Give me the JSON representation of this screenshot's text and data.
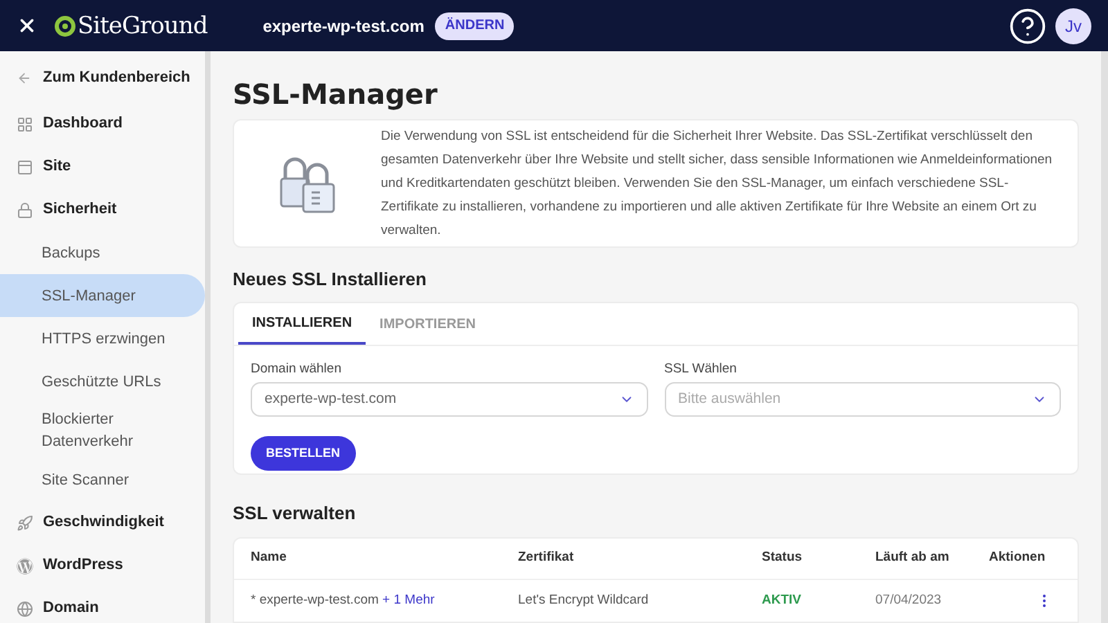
{
  "header": {
    "logo": "SiteGround",
    "domain": "experte-wp-test.com",
    "change_button": "ÄNDERN",
    "avatar": "Jv"
  },
  "sidebar": {
    "back": "Zum Kundenbereich",
    "items": [
      {
        "label": "Dashboard",
        "kind": "section",
        "selected": false
      },
      {
        "label": "Site",
        "kind": "section",
        "selected": false
      },
      {
        "label": "Sicherheit",
        "kind": "section",
        "selected": false
      },
      {
        "label": "Backups",
        "kind": "sub",
        "selected": false
      },
      {
        "label": "SSL-Manager",
        "kind": "sub",
        "selected": true
      },
      {
        "label": "HTTPS erzwingen",
        "kind": "sub",
        "selected": false
      },
      {
        "label": "Geschützte URLs",
        "kind": "sub",
        "selected": false
      },
      {
        "label": "Blockierter Datenverkehr",
        "kind": "sub",
        "selected": false
      },
      {
        "label": "Site Scanner",
        "kind": "sub",
        "selected": false
      },
      {
        "label": "Geschwindigkeit",
        "kind": "section",
        "selected": false
      },
      {
        "label": "WordPress",
        "kind": "section",
        "selected": false
      },
      {
        "label": "Domain",
        "kind": "section",
        "selected": false
      }
    ]
  },
  "page_title": "SSL-Manager",
  "intro": "Die Verwendung von SSL ist entscheidend für die Sicherheit Ihrer Website. Das SSL-Zertifikat verschlüsselt den gesamten Datenverkehr über Ihre Website und stellt sicher, dass sensible Informationen wie Anmeldeinformationen und Kreditkartendaten geschützt bleiben. Verwenden Sie den SSL-Manager, um einfach verschiedene SSL-Zertifikate zu installieren, vorhandene zu importieren und alle aktiven Zertifikate für Ihre Website an einem Ort zu verwalten.",
  "install": {
    "title": "Neues SSL Installieren",
    "tabs": [
      {
        "label": "INSTALLIEREN",
        "selected": true
      },
      {
        "label": "IMPORTIEREN",
        "selected": false
      }
    ],
    "fields": [
      {
        "label": "Domain wählen",
        "value": "experte-wp-test.com"
      },
      {
        "label": "SSL Wählen",
        "placeholder": "Bitte auswählen"
      }
    ],
    "order_button": "BESTELLEN"
  },
  "manage": {
    "title": "SSL verwalten",
    "columns": [
      "Name",
      "Zertifikat",
      "Status",
      "Läuft ab am",
      "Aktionen"
    ],
    "rows": [
      {
        "name": "* experte-wp-test.com",
        "more": "+ 1 Mehr",
        "certificate": "Let's Encrypt Wildcard",
        "status": "AKTIV",
        "expires": "07/04/2023"
      }
    ]
  }
}
